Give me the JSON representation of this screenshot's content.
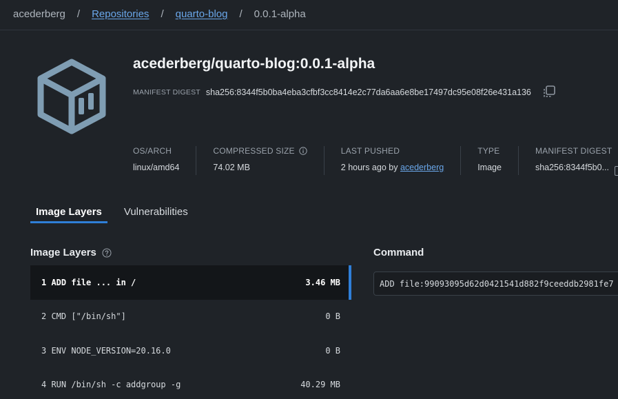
{
  "breadcrumb": {
    "user": "acederberg",
    "repositories": "Repositories",
    "repo": "quarto-blog",
    "tag": "0.0.1-alpha",
    "separator": "/"
  },
  "header": {
    "title": "acederberg/quarto-blog:0.0.1-alpha",
    "digest_label": "MANIFEST DIGEST",
    "digest_value": "sha256:8344f5b0ba4eba3cfbf3cc8414e2c77da6aa6e8be17497dc95e08f26e431a136"
  },
  "meta": {
    "os_arch_label": "OS/ARCH",
    "os_arch_value": "linux/amd64",
    "size_label": "COMPRESSED SIZE",
    "size_value": "74.02 MB",
    "pushed_label": "LAST PUSHED",
    "pushed_prefix": "2 hours ago by",
    "pushed_user": "acederberg",
    "type_label": "TYPE",
    "type_value": "Image",
    "digest_label": "MANIFEST DIGEST",
    "digest_value": "sha256:8344f5b0..."
  },
  "tabs": [
    {
      "label": "Image Layers",
      "active": true
    },
    {
      "label": "Vulnerabilities",
      "active": false
    }
  ],
  "layers_section": {
    "title": "Image Layers",
    "rows": [
      {
        "command": "1 ADD file ... in /",
        "size": "3.46 MB",
        "selected": true
      },
      {
        "command": "2 CMD [\"/bin/sh\"]",
        "size": "0 B",
        "selected": false
      },
      {
        "command": "3 ENV NODE_VERSION=20.16.0",
        "size": "0 B",
        "selected": false
      },
      {
        "command": "4 RUN /bin/sh -c addgroup -g",
        "size": "40.29 MB",
        "selected": false
      }
    ]
  },
  "command_section": {
    "title": "Command",
    "text": "ADD file:99093095d62d0421541d882f9ceeddb2981fe7"
  },
  "colors": {
    "background": "#1f2328",
    "accent": "#2f7fd8",
    "link": "#6aa7ea",
    "logo": "#7f9db3"
  },
  "icons": {
    "logo": "container-box-icon",
    "copy": "copy-icon",
    "info": "info-icon",
    "help": "help-icon"
  }
}
